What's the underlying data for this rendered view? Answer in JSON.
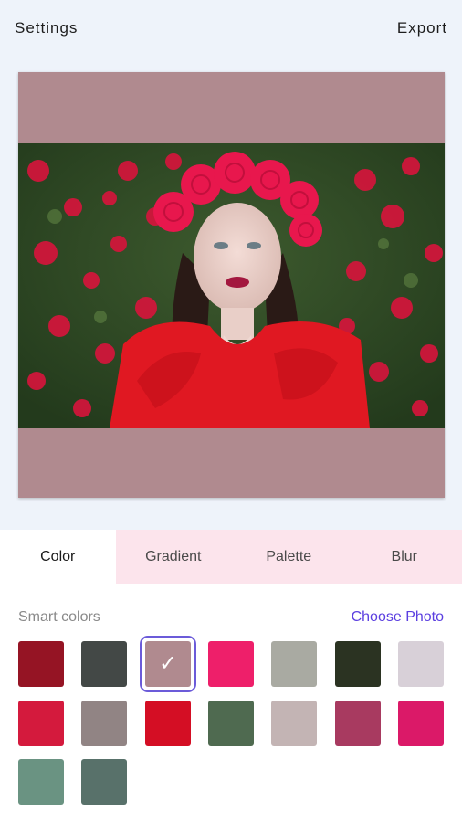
{
  "header": {
    "settings_label": "Settings",
    "export_label": "Export"
  },
  "canvas": {
    "background": "#b08a8f"
  },
  "tabs": [
    {
      "label": "Color",
      "active": true
    },
    {
      "label": "Gradient",
      "active": false
    },
    {
      "label": "Palette",
      "active": false
    },
    {
      "label": "Blur",
      "active": false
    }
  ],
  "smart_colors": {
    "label": "Smart colors",
    "choose_photo_label": "Choose Photo",
    "selected_index": 2,
    "swatches": [
      "#951424",
      "#434846",
      "#b08a8f",
      "#ee1f6a",
      "#a9aaa2",
      "#2b3322",
      "#d8d0d8",
      "#d41a3d",
      "#918484",
      "#d40e24",
      "#4f6a50",
      "#c3b4b4",
      "#a83a60",
      "#db1968",
      "#6a9382",
      "#58716a"
    ]
  }
}
